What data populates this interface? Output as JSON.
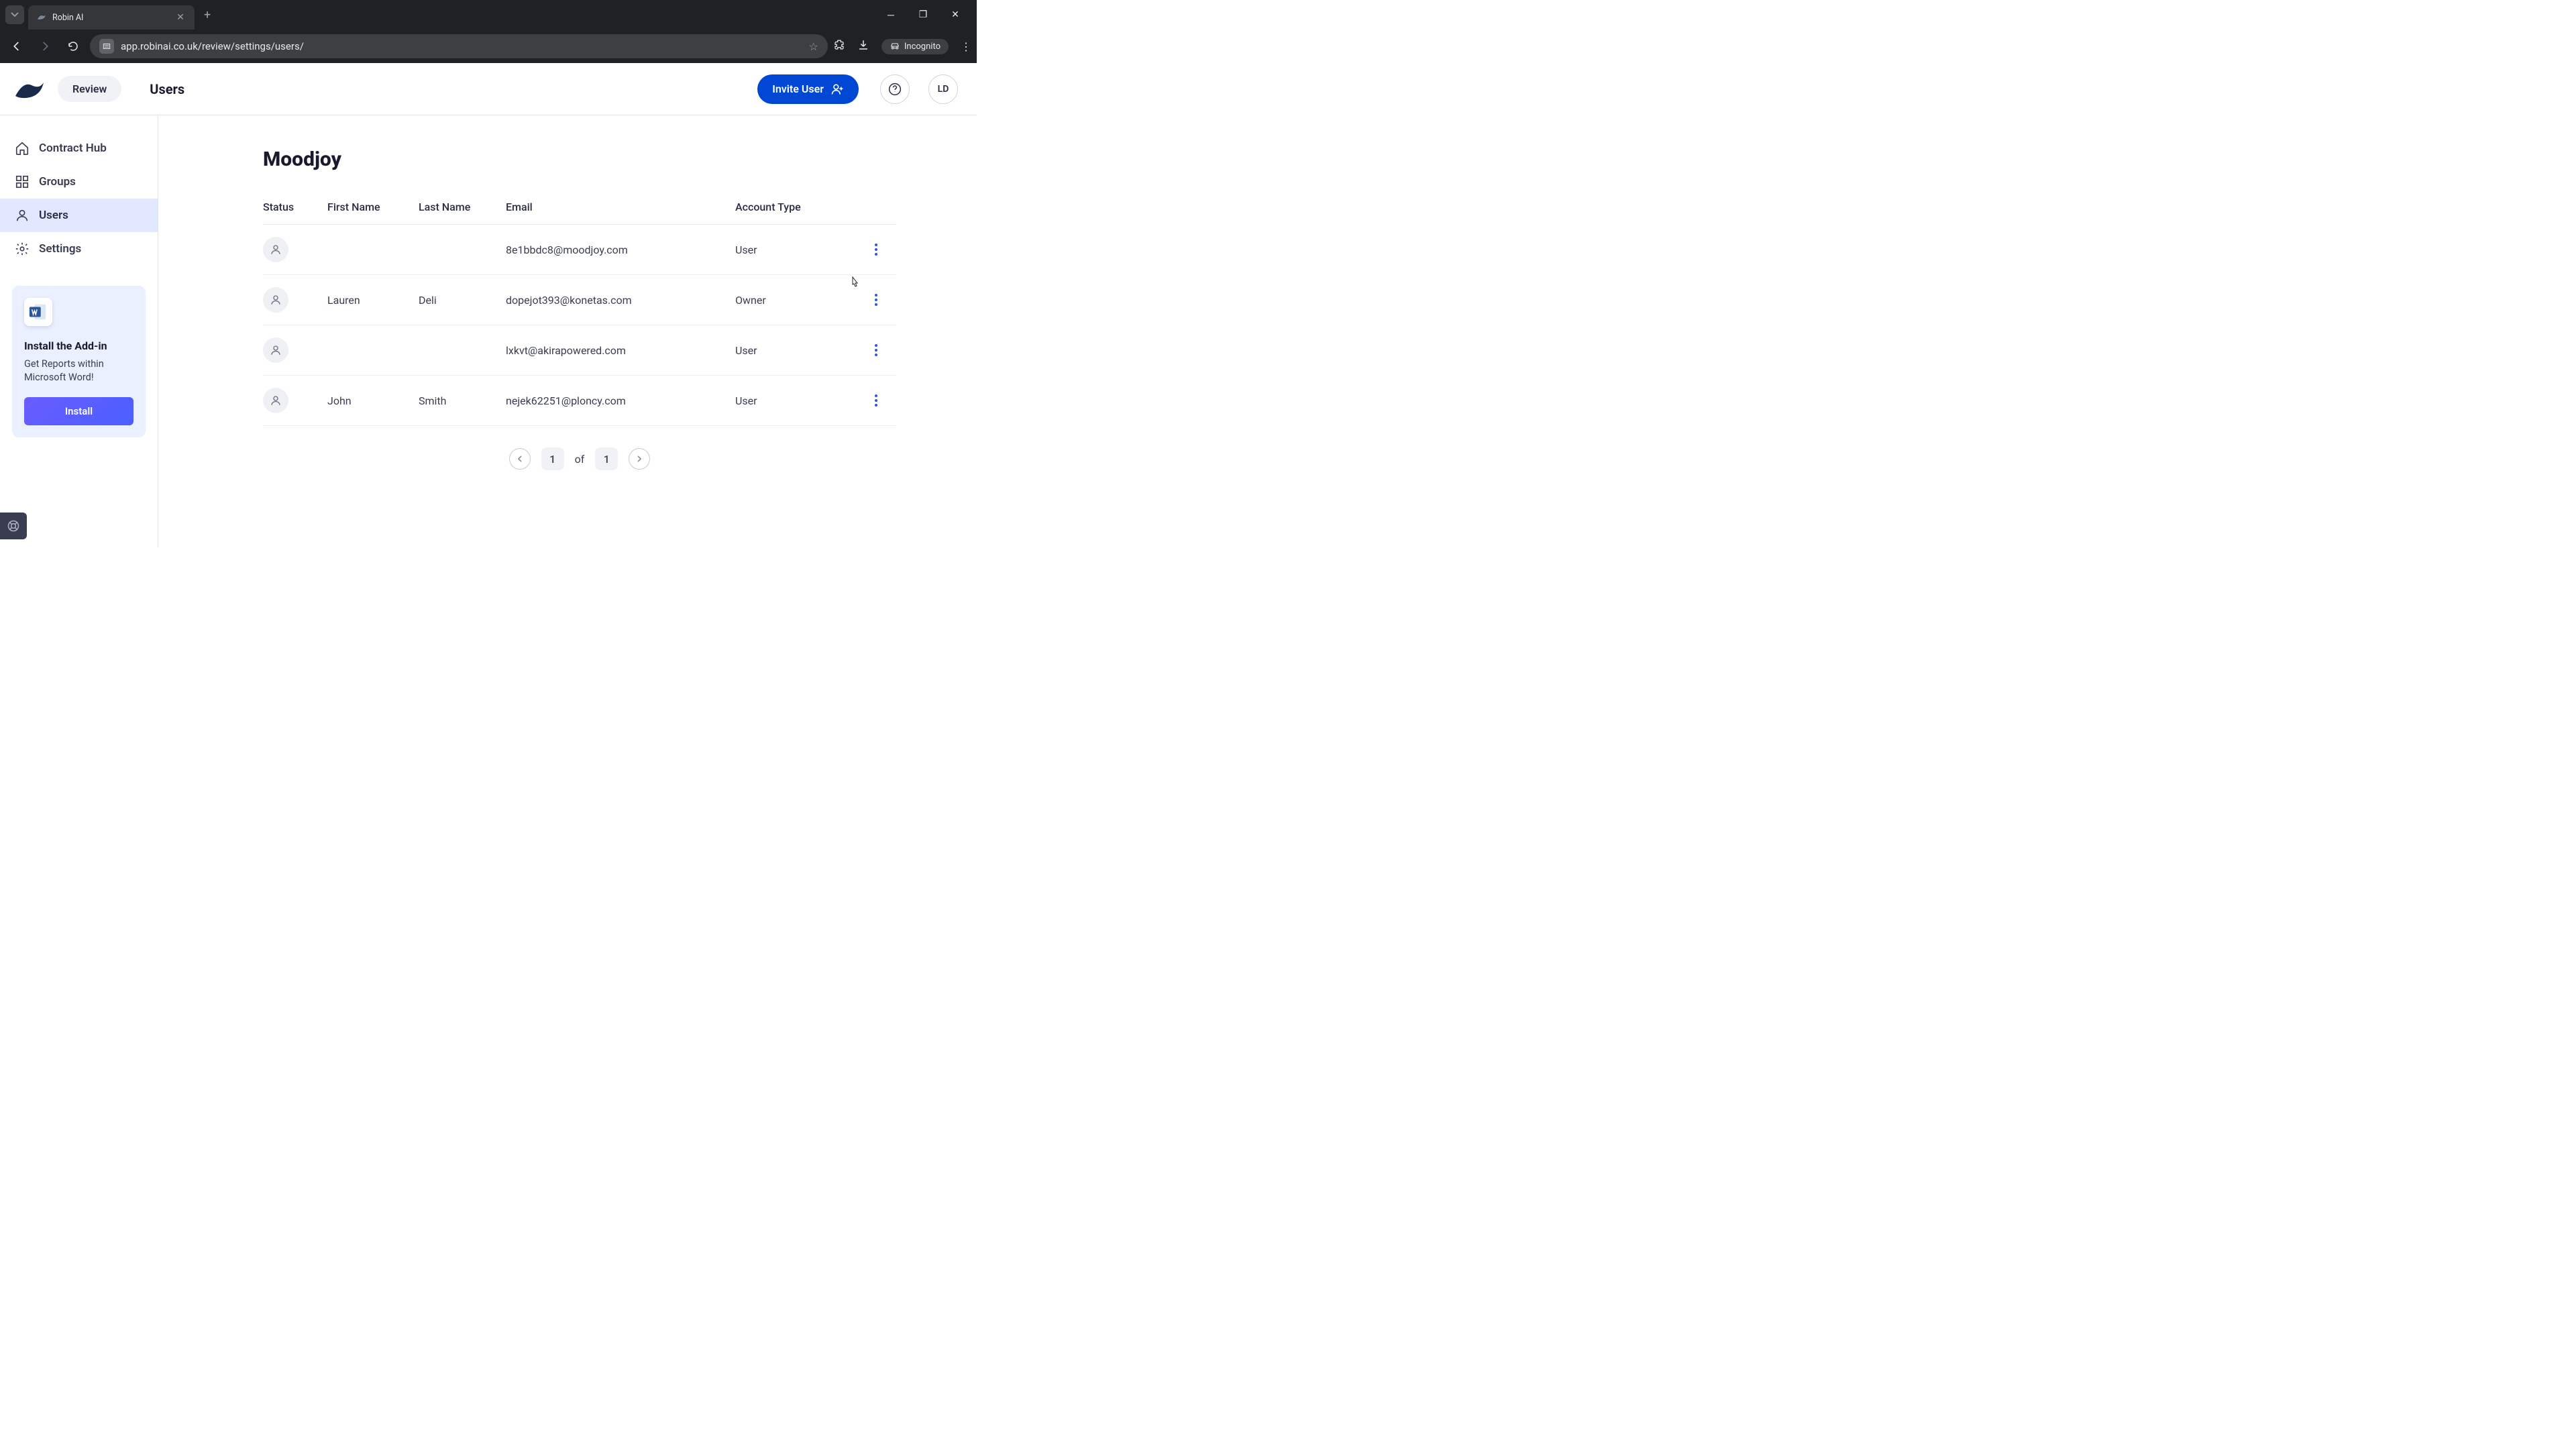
{
  "browser": {
    "tab_title": "Robin AI",
    "url": "app.robinai.co.uk/review/settings/users/",
    "incognito_label": "Incognito"
  },
  "header": {
    "review_label": "Review",
    "page_title": "Users",
    "invite_label": "Invite User",
    "avatar_initials": "LD"
  },
  "sidebar": {
    "items": [
      {
        "label": "Contract Hub",
        "icon": "home-icon"
      },
      {
        "label": "Groups",
        "icon": "grid-icon"
      },
      {
        "label": "Users",
        "icon": "user-icon"
      },
      {
        "label": "Settings",
        "icon": "gear-icon"
      }
    ],
    "addin": {
      "title": "Install the Add-in",
      "subtitle": "Get Reports within Microsoft Word!",
      "button": "Install"
    }
  },
  "main": {
    "org_name": "Moodjoy",
    "columns": {
      "status": "Status",
      "first": "First Name",
      "last": "Last Name",
      "email": "Email",
      "type": "Account Type"
    },
    "rows": [
      {
        "first": "",
        "last": "",
        "email": "8e1bbdc8@moodjoy.com",
        "type": "User"
      },
      {
        "first": "Lauren",
        "last": "Deli",
        "email": "dopejot393@konetas.com",
        "type": "Owner"
      },
      {
        "first": "",
        "last": "",
        "email": "lxkvt@akirapowered.com",
        "type": "User"
      },
      {
        "first": "John",
        "last": "Smith",
        "email": "nejek62251@ploncy.com",
        "type": "User"
      }
    ],
    "pagination": {
      "current": "1",
      "of_label": "of",
      "total": "1"
    }
  }
}
